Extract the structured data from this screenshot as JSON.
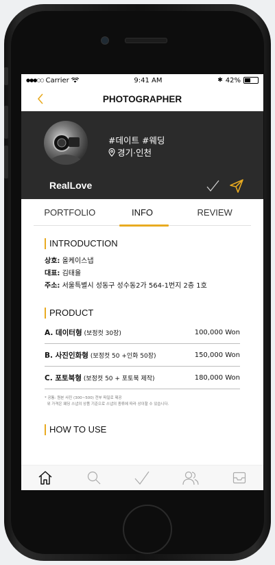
{
  "status_bar": {
    "signal": "●●●○○",
    "carrier": "Carrier",
    "time": "9:41 AM",
    "bluetooth": "✱",
    "battery_text": "42%",
    "battery_level": 0.42
  },
  "nav": {
    "title": "PHOTOGRAPHER"
  },
  "profile": {
    "tags": "#데이트 #웨딩",
    "location": "경기·인천",
    "name": "RealLove"
  },
  "tabs": [
    {
      "label": "PORTFOLIO"
    },
    {
      "label": "INFO"
    },
    {
      "label": "REVIEW"
    }
  ],
  "introduction": {
    "title": "INTRODUCTION",
    "lines": [
      {
        "label": "상호:",
        "value": " 올케이스냅"
      },
      {
        "label": "대표:",
        "value": " 김태율"
      },
      {
        "label": "주소:",
        "value": " 서울특별시 성동구 성수동2가 564-1번지 2층 1호"
      }
    ]
  },
  "product": {
    "title": "PRODUCT",
    "items": [
      {
        "name": "A. 데이터형",
        "detail": " (보정컷 30장)",
        "price": "100,000 Won"
      },
      {
        "name": "B. 사진인화형",
        "detail": " (보정컷 50 +인화 50장)",
        "price": "150,000 Won"
      },
      {
        "name": "C. 포토북형",
        "detail": " (보정컷 50 + 포토북 제작)",
        "price": "180,000 Won"
      }
    ],
    "notes": [
      "* 공통: 원본 사진 (300~500) 전부 파일로 제공",
      "  위 가격은 웨딩 스냅의 상품 기준으로 스냅의 종류에 따라 상이할 수 있습니다."
    ]
  },
  "how_to_use": {
    "title": "HOW TO USE"
  },
  "colors": {
    "accent": "#e8aa20",
    "profile_bg": "#2b2b2b"
  },
  "tabbar_icons": [
    "home-icon",
    "search-icon",
    "check-icon",
    "people-icon",
    "inbox-icon"
  ]
}
